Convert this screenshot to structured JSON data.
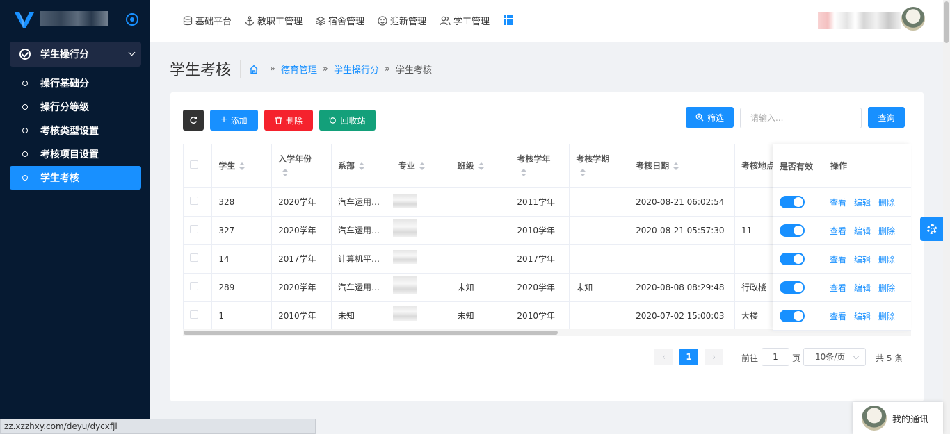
{
  "sidebar": {
    "group_label": "学生操行分",
    "items": [
      {
        "label": "操行基础分"
      },
      {
        "label": "操行分等级"
      },
      {
        "label": "考核类型设置"
      },
      {
        "label": "考核项目设置"
      },
      {
        "label": "学生考核",
        "active": true
      }
    ]
  },
  "topnav": {
    "items": [
      {
        "label": "基础平台",
        "icon": "database-icon"
      },
      {
        "label": "教职工管理",
        "icon": "anchor-icon"
      },
      {
        "label": "宿舍管理",
        "icon": "layers-icon"
      },
      {
        "label": "迎新管理",
        "icon": "smile-icon"
      },
      {
        "label": "学工管理",
        "icon": "users-icon"
      }
    ],
    "apps_icon": "grid-icon"
  },
  "page": {
    "title": "学生考核",
    "breadcrumb": [
      "德育管理",
      "学生操行分",
      "学生考核"
    ]
  },
  "toolbar": {
    "refresh_icon": "refresh-icon",
    "add_label": "添加",
    "delete_label": "删除",
    "recycle_label": "回收站",
    "filter_label": "筛选",
    "search_placeholder": "请输入...",
    "query_label": "查询"
  },
  "colors": {
    "primary": "#1890ff",
    "danger": "#f5222d",
    "success": "#13a07a",
    "dark": "#333333",
    "sidebar_bg": "#061a32"
  },
  "table": {
    "columns": [
      "学生",
      "入学年份",
      "系部",
      "专业",
      "班级",
      "考核学年",
      "考核学期",
      "考核日期",
      "考核地点",
      "是否有效",
      "操作"
    ],
    "rows": [
      {
        "student": "328",
        "year": "2020学年",
        "dept": "汽车运用…",
        "major": "",
        "class": "",
        "eval_year": "2011学年",
        "term": "",
        "date": "2020-08-21 06:02:54",
        "place": "",
        "valid": true
      },
      {
        "student": "327",
        "year": "2020学年",
        "dept": "汽车运用…",
        "major": "",
        "class": "",
        "eval_year": "2010学年",
        "term": "",
        "date": "2020-08-21 05:57:30",
        "place": "11",
        "valid": true
      },
      {
        "student": "14",
        "year": "2017学年",
        "dept": "计算机平…",
        "major": "",
        "class": "",
        "eval_year": "2017学年",
        "term": "",
        "date": "",
        "place": "",
        "valid": true
      },
      {
        "student": "289",
        "year": "2020学年",
        "dept": "汽车运用…",
        "major": "",
        "class": "未知",
        "eval_year": "2020学年",
        "term": "未知",
        "date": "2020-08-08 08:29:48",
        "place": "行政楼",
        "valid": true
      },
      {
        "student": "1",
        "year": "2010学年",
        "dept": "未知",
        "major": "",
        "class": "未知",
        "eval_year": "2010学年",
        "term": "",
        "date": "2020-07-02 15:00:03",
        "place": "大楼",
        "valid": true
      }
    ],
    "actions": [
      "查看",
      "编辑",
      "删除"
    ]
  },
  "pager": {
    "current_page": "1",
    "goto_prefix": "前往",
    "goto_value": "1",
    "goto_suffix": "页",
    "page_size": "10条/页",
    "total": "共 5 条"
  },
  "chat": {
    "label": "我的通讯"
  },
  "status_url": "zz.xzzhxy.com/deyu/dycxfjl"
}
